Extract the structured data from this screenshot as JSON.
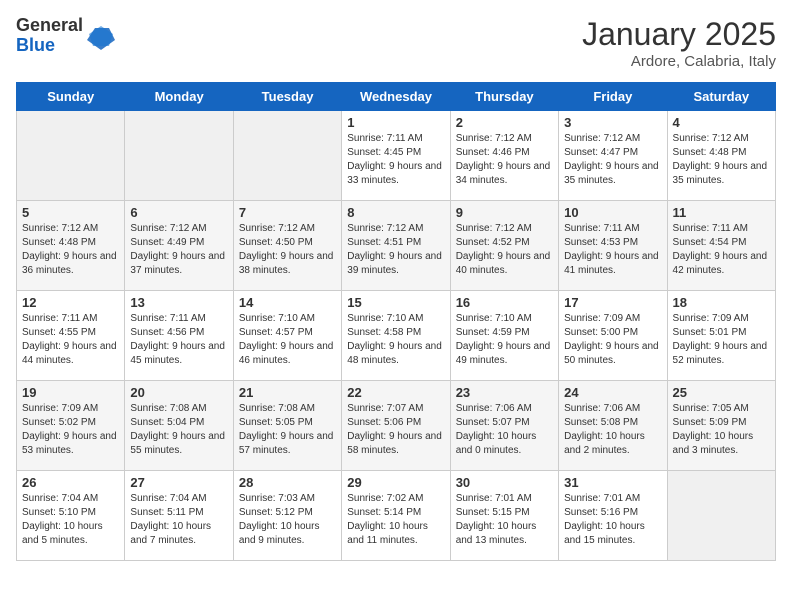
{
  "logo": {
    "general": "General",
    "blue": "Blue"
  },
  "title": "January 2025",
  "subtitle": "Ardore, Calabria, Italy",
  "days_of_week": [
    "Sunday",
    "Monday",
    "Tuesday",
    "Wednesday",
    "Thursday",
    "Friday",
    "Saturday"
  ],
  "weeks": [
    [
      {
        "num": "",
        "info": ""
      },
      {
        "num": "",
        "info": ""
      },
      {
        "num": "",
        "info": ""
      },
      {
        "num": "1",
        "info": "Sunrise: 7:11 AM\nSunset: 4:45 PM\nDaylight: 9 hours and 33 minutes."
      },
      {
        "num": "2",
        "info": "Sunrise: 7:12 AM\nSunset: 4:46 PM\nDaylight: 9 hours and 34 minutes."
      },
      {
        "num": "3",
        "info": "Sunrise: 7:12 AM\nSunset: 4:47 PM\nDaylight: 9 hours and 35 minutes."
      },
      {
        "num": "4",
        "info": "Sunrise: 7:12 AM\nSunset: 4:48 PM\nDaylight: 9 hours and 35 minutes."
      }
    ],
    [
      {
        "num": "5",
        "info": "Sunrise: 7:12 AM\nSunset: 4:48 PM\nDaylight: 9 hours and 36 minutes."
      },
      {
        "num": "6",
        "info": "Sunrise: 7:12 AM\nSunset: 4:49 PM\nDaylight: 9 hours and 37 minutes."
      },
      {
        "num": "7",
        "info": "Sunrise: 7:12 AM\nSunset: 4:50 PM\nDaylight: 9 hours and 38 minutes."
      },
      {
        "num": "8",
        "info": "Sunrise: 7:12 AM\nSunset: 4:51 PM\nDaylight: 9 hours and 39 minutes."
      },
      {
        "num": "9",
        "info": "Sunrise: 7:12 AM\nSunset: 4:52 PM\nDaylight: 9 hours and 40 minutes."
      },
      {
        "num": "10",
        "info": "Sunrise: 7:11 AM\nSunset: 4:53 PM\nDaylight: 9 hours and 41 minutes."
      },
      {
        "num": "11",
        "info": "Sunrise: 7:11 AM\nSunset: 4:54 PM\nDaylight: 9 hours and 42 minutes."
      }
    ],
    [
      {
        "num": "12",
        "info": "Sunrise: 7:11 AM\nSunset: 4:55 PM\nDaylight: 9 hours and 44 minutes."
      },
      {
        "num": "13",
        "info": "Sunrise: 7:11 AM\nSunset: 4:56 PM\nDaylight: 9 hours and 45 minutes."
      },
      {
        "num": "14",
        "info": "Sunrise: 7:10 AM\nSunset: 4:57 PM\nDaylight: 9 hours and 46 minutes."
      },
      {
        "num": "15",
        "info": "Sunrise: 7:10 AM\nSunset: 4:58 PM\nDaylight: 9 hours and 48 minutes."
      },
      {
        "num": "16",
        "info": "Sunrise: 7:10 AM\nSunset: 4:59 PM\nDaylight: 9 hours and 49 minutes."
      },
      {
        "num": "17",
        "info": "Sunrise: 7:09 AM\nSunset: 5:00 PM\nDaylight: 9 hours and 50 minutes."
      },
      {
        "num": "18",
        "info": "Sunrise: 7:09 AM\nSunset: 5:01 PM\nDaylight: 9 hours and 52 minutes."
      }
    ],
    [
      {
        "num": "19",
        "info": "Sunrise: 7:09 AM\nSunset: 5:02 PM\nDaylight: 9 hours and 53 minutes."
      },
      {
        "num": "20",
        "info": "Sunrise: 7:08 AM\nSunset: 5:04 PM\nDaylight: 9 hours and 55 minutes."
      },
      {
        "num": "21",
        "info": "Sunrise: 7:08 AM\nSunset: 5:05 PM\nDaylight: 9 hours and 57 minutes."
      },
      {
        "num": "22",
        "info": "Sunrise: 7:07 AM\nSunset: 5:06 PM\nDaylight: 9 hours and 58 minutes."
      },
      {
        "num": "23",
        "info": "Sunrise: 7:06 AM\nSunset: 5:07 PM\nDaylight: 10 hours and 0 minutes."
      },
      {
        "num": "24",
        "info": "Sunrise: 7:06 AM\nSunset: 5:08 PM\nDaylight: 10 hours and 2 minutes."
      },
      {
        "num": "25",
        "info": "Sunrise: 7:05 AM\nSunset: 5:09 PM\nDaylight: 10 hours and 3 minutes."
      }
    ],
    [
      {
        "num": "26",
        "info": "Sunrise: 7:04 AM\nSunset: 5:10 PM\nDaylight: 10 hours and 5 minutes."
      },
      {
        "num": "27",
        "info": "Sunrise: 7:04 AM\nSunset: 5:11 PM\nDaylight: 10 hours and 7 minutes."
      },
      {
        "num": "28",
        "info": "Sunrise: 7:03 AM\nSunset: 5:12 PM\nDaylight: 10 hours and 9 minutes."
      },
      {
        "num": "29",
        "info": "Sunrise: 7:02 AM\nSunset: 5:14 PM\nDaylight: 10 hours and 11 minutes."
      },
      {
        "num": "30",
        "info": "Sunrise: 7:01 AM\nSunset: 5:15 PM\nDaylight: 10 hours and 13 minutes."
      },
      {
        "num": "31",
        "info": "Sunrise: 7:01 AM\nSunset: 5:16 PM\nDaylight: 10 hours and 15 minutes."
      },
      {
        "num": "",
        "info": ""
      }
    ]
  ]
}
